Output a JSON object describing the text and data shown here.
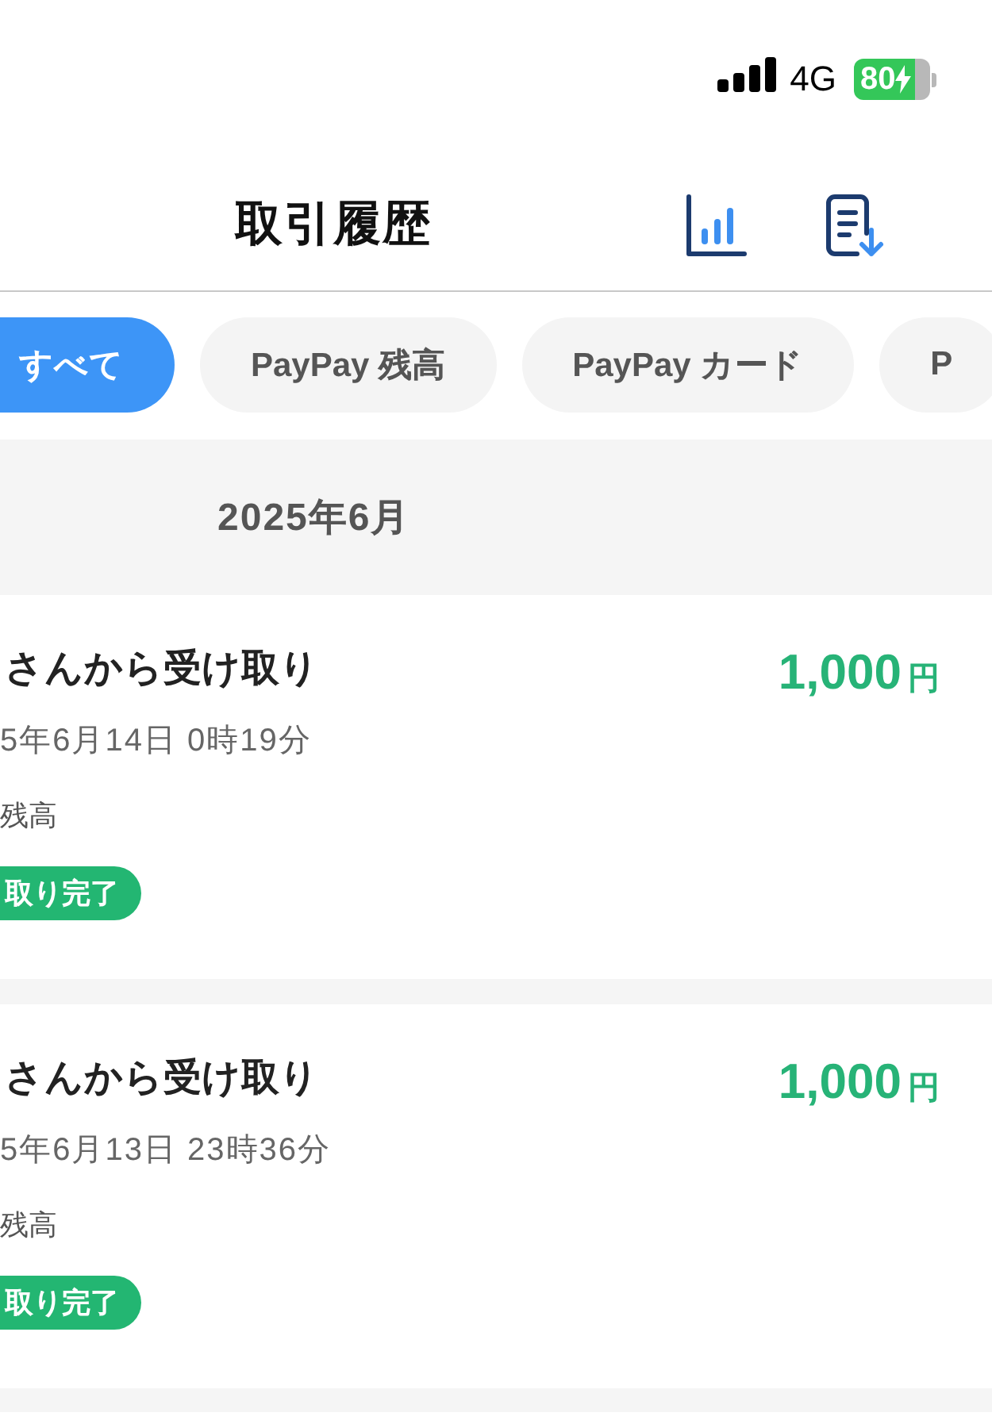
{
  "status_bar": {
    "network": "4G",
    "battery": "80"
  },
  "header": {
    "title": "取引履歴"
  },
  "filter_tabs": [
    {
      "label": "すべて",
      "selected": true
    },
    {
      "label": "PayPay 残高",
      "selected": false
    },
    {
      "label": "PayPay カード",
      "selected": false
    },
    {
      "label": "P",
      "selected": false
    }
  ],
  "month_header": "2025年6月",
  "transactions": [
    {
      "title": "さんから受け取り",
      "amount": "1,000",
      "currency": "円",
      "datetime": "5年6月14日 0時19分",
      "source": "残高",
      "status": "取り完了"
    },
    {
      "title": "さんから受け取り",
      "amount": "1,000",
      "currency": "円",
      "datetime": "5年6月13日 23時36分",
      "source": "残高",
      "status": "取り完了"
    }
  ]
}
